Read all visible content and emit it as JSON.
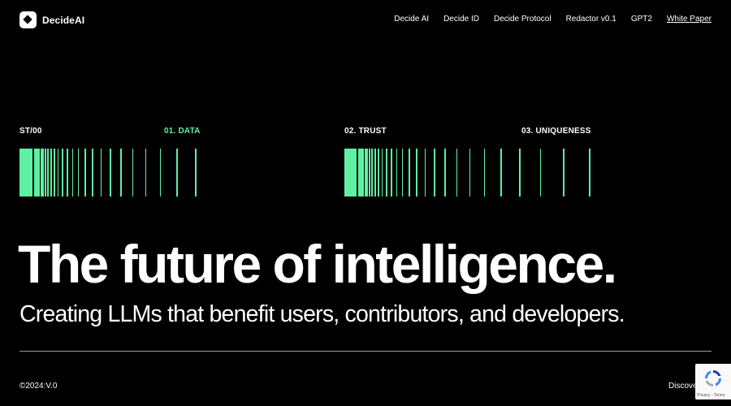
{
  "brand": {
    "name": "DecideAI"
  },
  "nav": {
    "items": [
      "Decide AI",
      "Decide ID",
      "Decide Protocol",
      "Redactor v0.1",
      "GPT2",
      "White Paper"
    ]
  },
  "stages": {
    "start": "ST/00",
    "data": "01. DATA",
    "trust": "02. TRUST",
    "uniqueness": "03. UNIQUENESS"
  },
  "hero": {
    "headline": "The future of intelligence.",
    "subheadline": "Creating LLMs that benefit users, contributors, and developers."
  },
  "footer": {
    "copyright": "©2024:V.0",
    "discover": "Discover"
  },
  "recaptcha": {
    "footer_text": "Privacy - Terms"
  },
  "colors": {
    "accent": "#5ff0a3",
    "background": "#000000",
    "text": "#ffffff"
  }
}
